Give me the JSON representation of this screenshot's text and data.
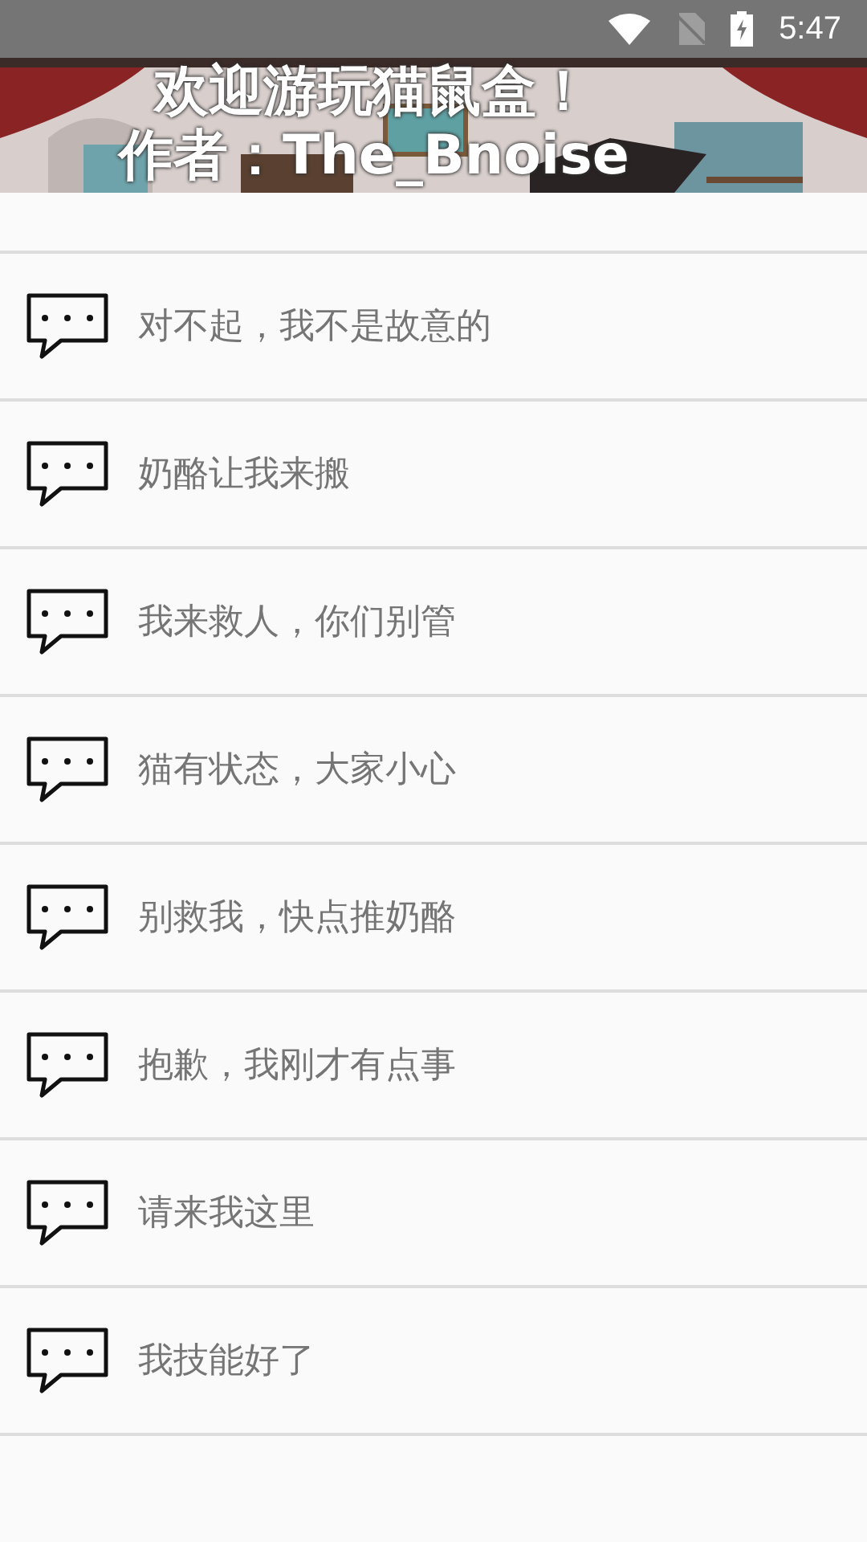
{
  "status_bar": {
    "time": "5:47"
  },
  "banner": {
    "kind": "picture",
    "lines": [
      "欢迎游玩猫鼠盒！",
      "作者：The_Bnoise"
    ]
  },
  "phrases": [
    {
      "text": "对不起，我不是故意的"
    },
    {
      "text": "奶酪让我来搬"
    },
    {
      "text": "我来救人，你们别管"
    },
    {
      "text": "猫有状态，大家小心"
    },
    {
      "text": "别救我，快点推奶酪"
    },
    {
      "text": "抱歉，我刚才有点事"
    },
    {
      "text": "请来我这里"
    },
    {
      "text": "我技能好了"
    }
  ]
}
